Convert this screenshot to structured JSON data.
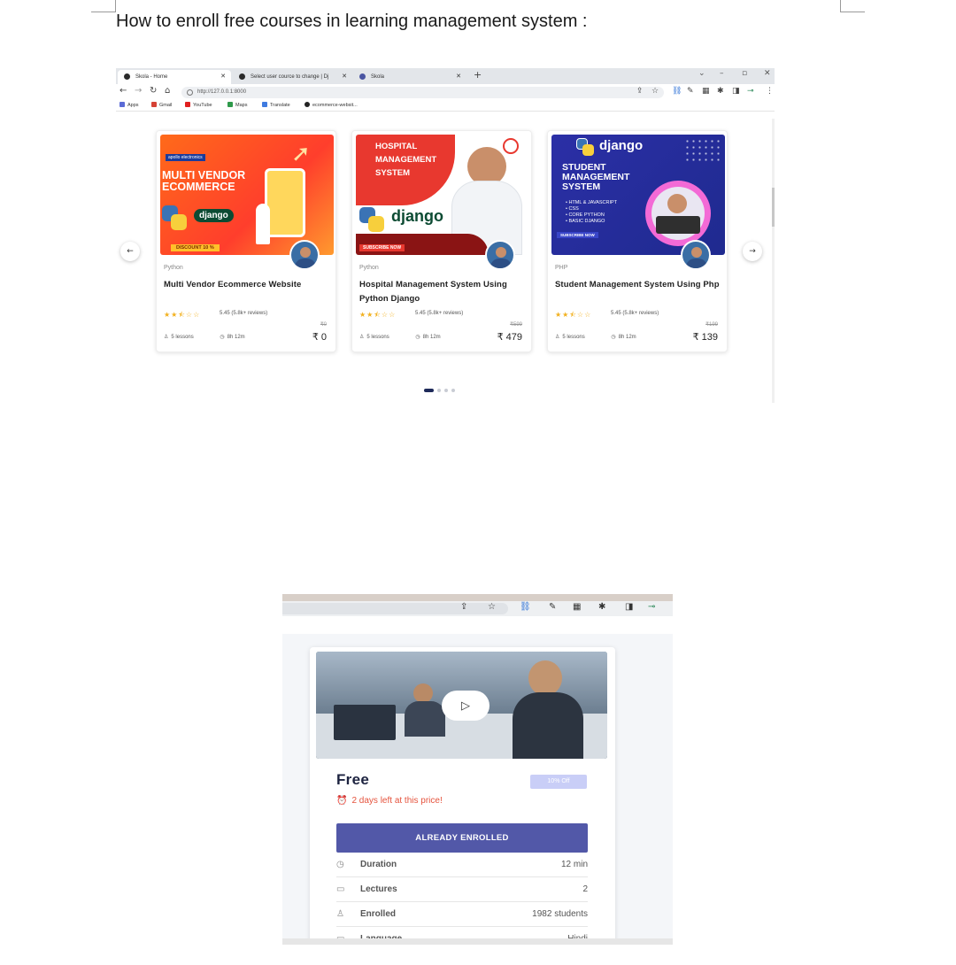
{
  "heading": "How to enroll free courses in learning management system :",
  "browser": {
    "tabs": [
      "Skola - Home",
      "Select user cource to change | Dj",
      "Skola"
    ],
    "url": "http://127.0.0.1:8000",
    "bookmarks": [
      "Apps",
      "Gmail",
      "YouTube",
      "Maps",
      "Translate",
      "ecommerce-websit..."
    ]
  },
  "courses": [
    {
      "category": "Python",
      "title": "Multi Vendor Ecommerce Website",
      "stars": "★★⯪☆☆",
      "rating": "5.45 (5.8k+ reviews)",
      "old_price": "₹0",
      "price": "₹ 0",
      "lessons": "5 lessons",
      "duration": "8h 12m",
      "banner": {
        "brand": "apollo electronics",
        "line1": "MULTI VENDOR",
        "line2": "ECOMMERCE",
        "logo": "django",
        "discount": "DISCOUNT 10 %"
      }
    },
    {
      "category": "Python",
      "title": "Hospital Management System Using Python Django",
      "stars": "★★⯪☆☆",
      "rating": "5.45 (5.8k+ reviews)",
      "old_price": "₹599",
      "price": "₹ 479",
      "lessons": "5 lessons",
      "duration": "8h 12m",
      "banner": {
        "line1": "HOSPITAL",
        "line2": "MANAGEMENT",
        "line3": "SYSTEM",
        "logo": "django",
        "cta": "SUBSCRIBE NOW"
      }
    },
    {
      "category": "PHP",
      "title": "Student Management System Using Php",
      "stars": "★★⯪☆☆",
      "rating": "5.45 (5.8k+ reviews)",
      "old_price": "₹199",
      "price": "₹ 139",
      "lessons": "5 lessons",
      "duration": "8h 12m",
      "banner": {
        "logo": "django",
        "line1": "STUDENT",
        "line2": "MANAGEMENT",
        "line3": "SYSTEM",
        "bullets": [
          "• HTML & JAVASCRIPT",
          "• CSS",
          "• CORE PYTHON",
          "• BASIC DJANGO"
        ],
        "cta": "SUBSCRIBE NOW"
      }
    }
  ],
  "enroll_panel": {
    "price_label": "Free",
    "discount_badge": "10% Off",
    "days_left": "2 days left at this price!",
    "button": "ALREADY ENROLLED",
    "details": [
      {
        "icon": "clock-icon",
        "glyph": "◷",
        "label": "Duration",
        "value": "12 min"
      },
      {
        "icon": "book-icon",
        "glyph": "▭",
        "label": "Lectures",
        "value": "2"
      },
      {
        "icon": "user-group-icon",
        "glyph": "♙",
        "label": "Enrolled",
        "value": "1982 students"
      },
      {
        "icon": "language-icon",
        "glyph": "▭",
        "label": "Language",
        "value": "Hindi"
      }
    ]
  },
  "colors": {
    "button": "#5258a8",
    "deadline": "#e5533d",
    "star": "#f2b01e",
    "price_heading": "#1d2340"
  }
}
